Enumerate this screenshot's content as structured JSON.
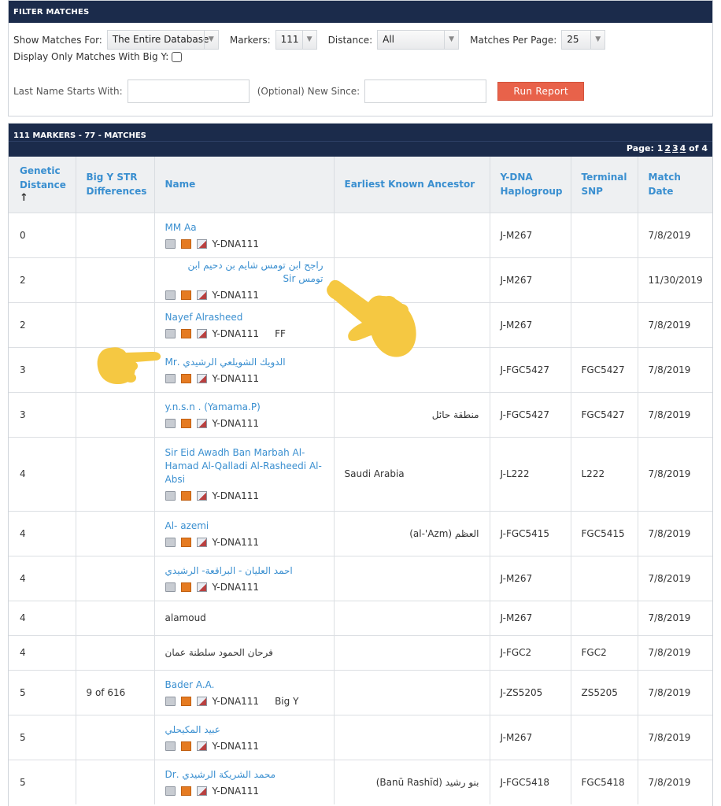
{
  "filter": {
    "title": "FILTER MATCHES",
    "show_label": "Show Matches For:",
    "show_value": "The Entire Database",
    "markers_label": "Markers:",
    "markers_value": "111",
    "distance_label": "Distance:",
    "distance_value": "All",
    "per_page_label": "Matches Per Page:",
    "per_page_value": "25",
    "bigy_label": "Display Only Matches With Big Y:",
    "lastname_label": "Last Name Starts With:",
    "newsince_label": "(Optional) New Since:",
    "run_button": "Run Report"
  },
  "results": {
    "title": "111 MARKERS - 77 - MATCHES",
    "page_label": "Page:",
    "page_current": "1",
    "pages": [
      "2",
      "3",
      "4"
    ],
    "page_of": "of 4",
    "headers": {
      "distance": "Genetic Distance",
      "sort_arrow": "↑",
      "bigy": "Big Y STR Differences",
      "name": "Name",
      "ancestor": "Earliest Known Ancestor",
      "haplogroup": "Y-DNA Haplogroup",
      "snp": "Terminal SNP",
      "date": "Match Date"
    },
    "rows": [
      {
        "distance": "0",
        "bigy": "",
        "name": "MM Aa",
        "test": "Y-DNA111",
        "extra": "",
        "ancestor": "",
        "haplogroup": "J-M267",
        "snp": "",
        "date": "7/8/2019"
      },
      {
        "distance": "2",
        "bigy": "",
        "name": "راجح ابن تومس شايم بن دحيم ابن تومس Sir",
        "test": "Y-DNA111",
        "extra": "",
        "ancestor": "",
        "haplogroup": "J-M267",
        "snp": "",
        "date": "11/30/2019"
      },
      {
        "distance": "2",
        "bigy": "",
        "name": "Nayef Alrasheed",
        "test": "Y-DNA111",
        "extra": "FF",
        "ancestor": "",
        "haplogroup": "J-M267",
        "snp": "",
        "date": "7/8/2019"
      },
      {
        "distance": "3",
        "bigy": "",
        "name": "الدويك الشويلعي الرشيدي .Mr",
        "test": "Y-DNA111",
        "extra": "",
        "ancestor": "",
        "haplogroup": "J-FGC5427",
        "snp": "FGC5427",
        "date": "7/8/2019"
      },
      {
        "distance": "3",
        "bigy": "",
        "name": "y.n.s.n . (Yamama.P)",
        "test": "Y-DNA111",
        "extra": "",
        "ancestor": "منطقة حائل",
        "haplogroup": "J-FGC5427",
        "snp": "FGC5427",
        "date": "7/8/2019"
      },
      {
        "distance": "4",
        "bigy": "",
        "name": "Sir Eid Awadh Ban Marbah Al-Hamad Al-Qalladi Al-Rasheedi Al-Absi",
        "test": "Y-DNA111",
        "extra": "",
        "ancestor": "Saudi Arabia",
        "haplogroup": "J-L222",
        "snp": "L222",
        "date": "7/8/2019"
      },
      {
        "distance": "4",
        "bigy": "",
        "name": "Al- azemi",
        "test": "Y-DNA111",
        "extra": "",
        "ancestor": "العظم (al-'Azm)",
        "haplogroup": "J-FGC5415",
        "snp": "FGC5415",
        "date": "7/8/2019"
      },
      {
        "distance": "4",
        "bigy": "",
        "name": "احمد العليان - البراقعة- الرشيدي",
        "test": "Y-DNA111",
        "extra": "",
        "ancestor": "",
        "haplogroup": "J-M267",
        "snp": "",
        "date": "7/8/2019"
      },
      {
        "distance": "4",
        "bigy": "",
        "name": "alamoud",
        "test": "",
        "extra": "",
        "ancestor": "",
        "haplogroup": "J-M267",
        "snp": "",
        "date": "7/8/2019"
      },
      {
        "distance": "4",
        "bigy": "",
        "name": "فرحان الحمود سلطنة عمان",
        "test": "",
        "extra": "",
        "ancestor": "",
        "haplogroup": "J-FGC2",
        "snp": "FGC2",
        "date": "7/8/2019"
      },
      {
        "distance": "5",
        "bigy": "9 of 616",
        "name": "Bader A.A.",
        "test": "Y-DNA111",
        "extra": "Big Y",
        "ancestor": "",
        "haplogroup": "J-ZS5205",
        "snp": "ZS5205",
        "date": "7/8/2019"
      },
      {
        "distance": "5",
        "bigy": "",
        "name": "عبيد المكيحلي",
        "test": "Y-DNA111",
        "extra": "",
        "ancestor": "",
        "haplogroup": "J-M267",
        "snp": "",
        "date": "7/8/2019"
      },
      {
        "distance": "5",
        "bigy": "",
        "name": "محمد الشريكة الرشيدي .Dr",
        "test": "Y-DNA111",
        "extra": "",
        "ancestor": "بنو رشيد (Banū Rashīd)",
        "haplogroup": "J-FGC5418",
        "snp": "FGC5418",
        "date": "7/8/2019"
      }
    ]
  },
  "colors": {
    "header_navy": "#1b2b4b",
    "link_blue": "#3a8fd0",
    "run_button": "#e8624a",
    "hand_emoji": "#f5c842"
  },
  "icons": [
    "print-icon",
    "family-tree-icon",
    "certificate-icon",
    "pointing-hand-emoji"
  ]
}
